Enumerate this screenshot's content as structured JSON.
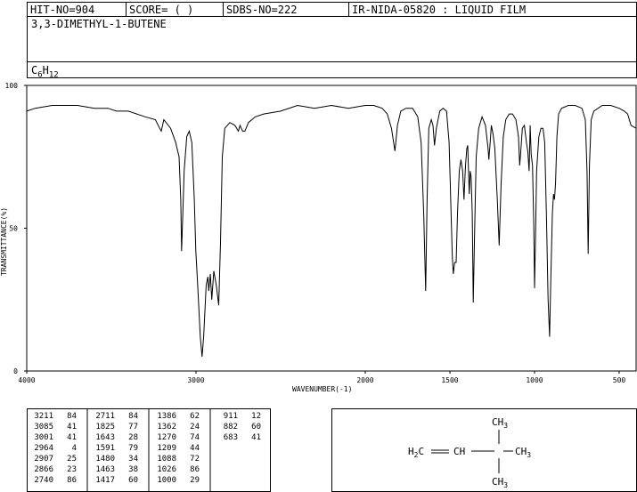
{
  "header": {
    "hit_no": "HIT-NO=904",
    "score": "SCORE=  (   )",
    "sdbs_no": "SDBS-NO=222",
    "method": "IR-NIDA-05820 : LIQUID FILM",
    "compound_name": "3,3-DIMETHYL-1-BUTENE",
    "formula_base": "C",
    "formula_c": "6",
    "formula_h_base": "H",
    "formula_h": "12"
  },
  "chart_data": {
    "type": "line",
    "title": "",
    "xlabel": "WAVENUMBER(-1)",
    "ylabel": "TRANSMITTANCE(%)",
    "xlim": [
      4000,
      400
    ],
    "ylim": [
      0,
      100
    ],
    "x_ticks": [
      4000,
      3000,
      2000,
      1500,
      1000,
      500
    ],
    "y_ticks": [
      0,
      50,
      100
    ],
    "grid": false,
    "series": [
      {
        "points": [
          [
            4000,
            91
          ],
          [
            3950,
            92
          ],
          [
            3850,
            93
          ],
          [
            3700,
            93
          ],
          [
            3600,
            92
          ],
          [
            3520,
            92
          ],
          [
            3470,
            91
          ],
          [
            3400,
            91
          ],
          [
            3300,
            89
          ],
          [
            3240,
            88
          ],
          [
            3215,
            85
          ],
          [
            3205,
            84
          ],
          [
            3190,
            88
          ],
          [
            3150,
            85
          ],
          [
            3120,
            80
          ],
          [
            3100,
            75
          ],
          [
            3090,
            60
          ],
          [
            3085,
            42
          ],
          [
            3078,
            55
          ],
          [
            3070,
            70
          ],
          [
            3055,
            82
          ],
          [
            3040,
            84
          ],
          [
            3025,
            80
          ],
          [
            3010,
            60
          ],
          [
            3001,
            42
          ],
          [
            2990,
            30
          ],
          [
            2975,
            12
          ],
          [
            2964,
            5
          ],
          [
            2955,
            12
          ],
          [
            2940,
            30
          ],
          [
            2930,
            33
          ],
          [
            2925,
            28
          ],
          [
            2915,
            34
          ],
          [
            2907,
            25
          ],
          [
            2895,
            35
          ],
          [
            2880,
            30
          ],
          [
            2866,
            23
          ],
          [
            2855,
            45
          ],
          [
            2845,
            75
          ],
          [
            2830,
            85
          ],
          [
            2800,
            87
          ],
          [
            2770,
            86
          ],
          [
            2750,
            84
          ],
          [
            2740,
            86
          ],
          [
            2725,
            84
          ],
          [
            2711,
            84
          ],
          [
            2690,
            87
          ],
          [
            2650,
            89
          ],
          [
            2600,
            90
          ],
          [
            2500,
            91
          ],
          [
            2400,
            93
          ],
          [
            2300,
            92
          ],
          [
            2200,
            93
          ],
          [
            2100,
            92
          ],
          [
            2000,
            93
          ],
          [
            1950,
            93
          ],
          [
            1900,
            92
          ],
          [
            1870,
            90
          ],
          [
            1845,
            85
          ],
          [
            1825,
            77
          ],
          [
            1810,
            86
          ],
          [
            1790,
            91
          ],
          [
            1760,
            92
          ],
          [
            1720,
            92
          ],
          [
            1690,
            89
          ],
          [
            1670,
            80
          ],
          [
            1655,
            55
          ],
          [
            1643,
            28
          ],
          [
            1635,
            60
          ],
          [
            1625,
            85
          ],
          [
            1610,
            88
          ],
          [
            1600,
            86
          ],
          [
            1591,
            79
          ],
          [
            1580,
            85
          ],
          [
            1560,
            91
          ],
          [
            1540,
            92
          ],
          [
            1520,
            91
          ],
          [
            1505,
            80
          ],
          [
            1495,
            60
          ],
          [
            1486,
            40
          ],
          [
            1480,
            34
          ],
          [
            1472,
            38
          ],
          [
            1463,
            38
          ],
          [
            1455,
            55
          ],
          [
            1445,
            70
          ],
          [
            1435,
            74
          ],
          [
            1425,
            70
          ],
          [
            1417,
            60
          ],
          [
            1408,
            72
          ],
          [
            1400,
            78
          ],
          [
            1395,
            79
          ],
          [
            1386,
            62
          ],
          [
            1380,
            70
          ],
          [
            1375,
            68
          ],
          [
            1368,
            55
          ],
          [
            1362,
            24
          ],
          [
            1355,
            45
          ],
          [
            1345,
            75
          ],
          [
            1330,
            85
          ],
          [
            1310,
            89
          ],
          [
            1290,
            86
          ],
          [
            1275,
            78
          ],
          [
            1270,
            74
          ],
          [
            1262,
            80
          ],
          [
            1255,
            86
          ],
          [
            1245,
            83
          ],
          [
            1235,
            78
          ],
          [
            1220,
            60
          ],
          [
            1209,
            44
          ],
          [
            1198,
            65
          ],
          [
            1185,
            82
          ],
          [
            1170,
            88
          ],
          [
            1150,
            90
          ],
          [
            1130,
            90
          ],
          [
            1110,
            88
          ],
          [
            1095,
            82
          ],
          [
            1088,
            72
          ],
          [
            1080,
            78
          ],
          [
            1072,
            85
          ],
          [
            1060,
            86
          ],
          [
            1048,
            80
          ],
          [
            1040,
            77
          ],
          [
            1032,
            70
          ],
          [
            1026,
            86
          ],
          [
            1020,
            76
          ],
          [
            1012,
            72
          ],
          [
            1005,
            52
          ],
          [
            1000,
            29
          ],
          [
            995,
            45
          ],
          [
            988,
            70
          ],
          [
            975,
            82
          ],
          [
            962,
            85
          ],
          [
            950,
            85
          ],
          [
            940,
            80
          ],
          [
            930,
            55
          ],
          [
            920,
            25
          ],
          [
            911,
            12
          ],
          [
            905,
            30
          ],
          [
            895,
            55
          ],
          [
            888,
            62
          ],
          [
            882,
            60
          ],
          [
            876,
            66
          ],
          [
            868,
            82
          ],
          [
            858,
            90
          ],
          [
            840,
            92
          ],
          [
            800,
            93
          ],
          [
            760,
            93
          ],
          [
            720,
            92
          ],
          [
            700,
            88
          ],
          [
            690,
            70
          ],
          [
            683,
            41
          ],
          [
            676,
            72
          ],
          [
            665,
            88
          ],
          [
            650,
            91
          ],
          [
            600,
            93
          ],
          [
            550,
            93
          ],
          [
            500,
            92
          ],
          [
            470,
            91
          ],
          [
            450,
            90
          ],
          [
            430,
            86
          ],
          [
            400,
            85
          ]
        ]
      }
    ]
  },
  "peak_table": {
    "columns": [
      [
        [
          "3211",
          "84"
        ],
        [
          "3085",
          "41"
        ],
        [
          "3001",
          "41"
        ],
        [
          "2964",
          "4"
        ],
        [
          "2907",
          "25"
        ],
        [
          "2866",
          "23"
        ],
        [
          "2740",
          "86"
        ]
      ],
      [
        [
          "2711",
          "84"
        ],
        [
          "1825",
          "77"
        ],
        [
          "1643",
          "28"
        ],
        [
          "1591",
          "79"
        ],
        [
          "1480",
          "34"
        ],
        [
          "1463",
          "38"
        ],
        [
          "1417",
          "60"
        ]
      ],
      [
        [
          "1386",
          "62"
        ],
        [
          "1362",
          "24"
        ],
        [
          "1270",
          "74"
        ],
        [
          "1209",
          "44"
        ],
        [
          "1088",
          "72"
        ],
        [
          "1026",
          "86"
        ],
        [
          "1000",
          "29"
        ]
      ],
      [
        [
          "911",
          "12"
        ],
        [
          "882",
          "60"
        ],
        [
          "683",
          "41"
        ]
      ]
    ]
  },
  "structure": {
    "top_methyl": "CH",
    "top_methyl_sub": "3",
    "bottom_methyl": "CH",
    "bottom_methyl_sub": "3",
    "right_methyl": "CH",
    "right_methyl_sub": "3",
    "vinyl_h2c": "H",
    "vinyl_h2c_sub": "2",
    "vinyl_c": "C",
    "ch": "CH",
    "double_bond": "═",
    "single_bond": "—"
  }
}
